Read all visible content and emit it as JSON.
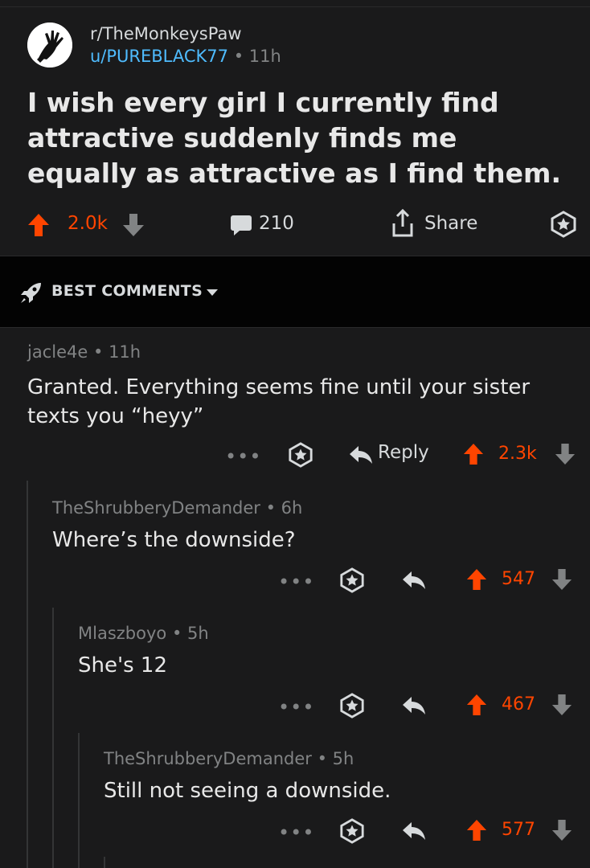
{
  "post": {
    "subreddit": "r/TheMonkeysPaw",
    "author": "u/PUREBLACK77",
    "separator": "•",
    "age": "11h",
    "title": "I wish every girl I currently find attractive suddenly finds me equally as attractive as I find them.",
    "score": "2.0k",
    "comments_count": "210",
    "share_label": "Share"
  },
  "sort": {
    "label": "BEST COMMENTS"
  },
  "comments": [
    {
      "author": "jacle4e",
      "age": "11h",
      "separator": "•",
      "body": "Granted. Everything seems fine until your sister texts you “heyy”",
      "more": "•••",
      "reply_label": "Reply",
      "score": "2.3k"
    },
    {
      "author": "TheShrubberyDemander",
      "age": "6h",
      "separator": "•",
      "body": "Where’s the downside?",
      "more": "•••",
      "score": "547"
    },
    {
      "author": "Mlaszboyo",
      "age": "5h",
      "separator": "•",
      "body": "She's 12",
      "more": "•••",
      "score": "467"
    },
    {
      "author": "TheShrubberyDemander",
      "age": "5h",
      "separator": "•",
      "body": "Still not seeing a downside.",
      "more": "•••",
      "score": "577"
    }
  ],
  "colors": {
    "background": "#1a1a1b",
    "sortbar": "#030303",
    "upvote": "#ff4500",
    "username_link": "#4fbcff",
    "muted": "#818384"
  },
  "icons": {
    "avatar": "monkey-paw-avatar",
    "upvote": "upvote-arrow-icon",
    "downvote": "downvote-arrow-icon",
    "comment": "comment-bubble-icon",
    "share": "share-icon",
    "award": "award-icon",
    "sort": "rocket-icon",
    "reply": "reply-arrow-icon"
  }
}
